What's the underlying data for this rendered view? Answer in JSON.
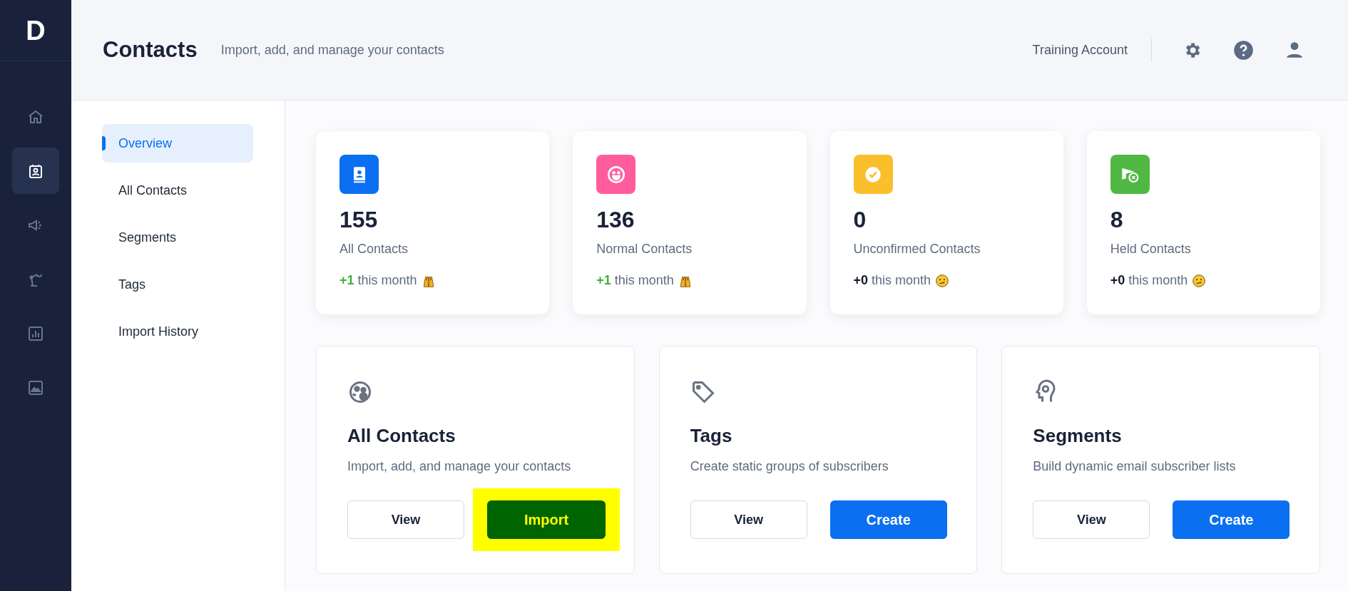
{
  "rail": {
    "logo": "D",
    "items": [
      {
        "selected": false
      },
      {
        "selected": true
      },
      {
        "selected": false
      },
      {
        "selected": false
      },
      {
        "selected": false
      },
      {
        "selected": false
      }
    ]
  },
  "header": {
    "title": "Contacts",
    "subtitle": "Import, add, and manage your contacts",
    "account": "Training Account"
  },
  "subnav": [
    {
      "label": "Overview",
      "selected": true
    },
    {
      "label": "All Contacts",
      "selected": false
    },
    {
      "label": "Segments",
      "selected": false
    },
    {
      "label": "Tags",
      "selected": false
    },
    {
      "label": "Import History",
      "selected": false
    }
  ],
  "stats": [
    {
      "value": "155",
      "label": "All Contacts",
      "delta": "+1",
      "period": "this month",
      "kind": "up",
      "color": "#0a6ff0"
    },
    {
      "value": "136",
      "label": "Normal Contacts",
      "delta": "+1",
      "period": "this month",
      "kind": "up",
      "color": "#ff5c9e"
    },
    {
      "value": "0",
      "label": "Unconfirmed Contacts",
      "delta": "+0",
      "period": "this month",
      "kind": "flat",
      "color": "#fbbf2c"
    },
    {
      "value": "8",
      "label": "Held Contacts",
      "delta": "+0",
      "period": "this month",
      "kind": "flat",
      "color": "#52b844"
    }
  ],
  "features": [
    {
      "title": "All Contacts",
      "description": "Import, add, and manage your contacts",
      "buttons": [
        {
          "label": "View",
          "kind": "secondary",
          "highlighted": false
        },
        {
          "label": "Import",
          "kind": "primary",
          "highlighted": true
        }
      ]
    },
    {
      "title": "Tags",
      "description": "Create static groups of subscribers",
      "buttons": [
        {
          "label": "View",
          "kind": "secondary",
          "highlighted": false
        },
        {
          "label": "Create",
          "kind": "primary",
          "highlighted": false
        }
      ]
    },
    {
      "title": "Segments",
      "description": "Build dynamic email subscriber lists",
      "buttons": [
        {
          "label": "View",
          "kind": "secondary",
          "highlighted": false
        },
        {
          "label": "Create",
          "kind": "primary",
          "highlighted": false
        }
      ]
    }
  ]
}
